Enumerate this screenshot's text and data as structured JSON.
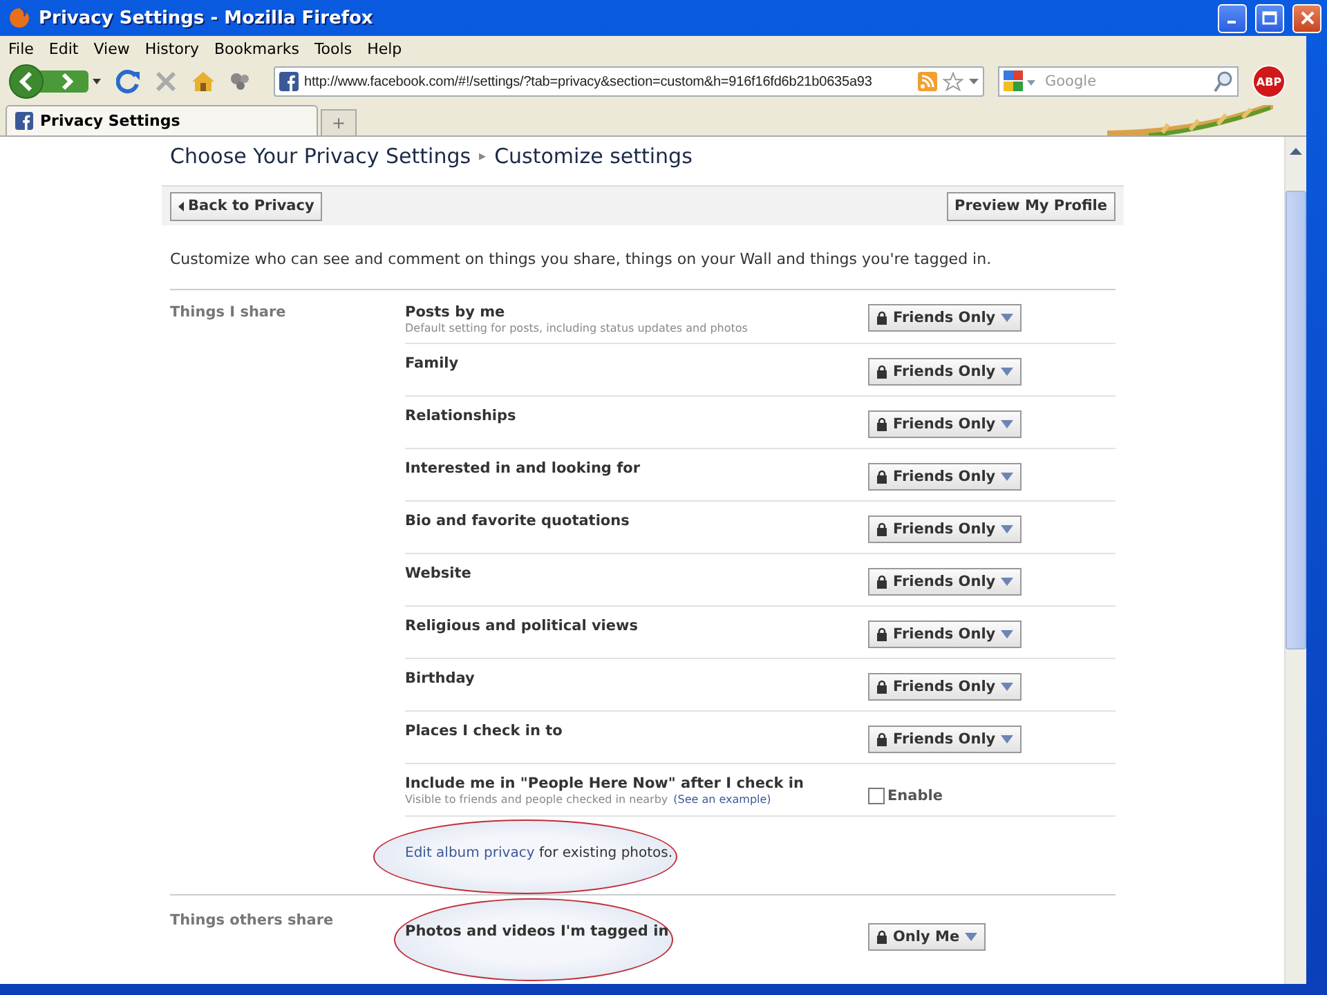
{
  "window": {
    "title": "Privacy Settings - Mozilla Firefox"
  },
  "menu": [
    "File",
    "Edit",
    "View",
    "History",
    "Bookmarks",
    "Tools",
    "Help"
  ],
  "address_bar": {
    "url": "http://www.facebook.com/#!/settings/?tab=privacy&section=custom&h=916f16fd6b21b0635a93"
  },
  "search": {
    "placeholder": "Google"
  },
  "adblock_label": "ABP",
  "tabs": [
    {
      "label": "Privacy Settings",
      "selected": true
    }
  ],
  "new_tab": "+",
  "breadcrumb": [
    "Choose Your Privacy Settings",
    "Customize settings"
  ],
  "breadcrumb_separator": "▸",
  "back_button": "Back to Privacy",
  "preview_button": "Preview My Profile",
  "intro": "Customize who can see and comment on things you share, things on your Wall and things you're tagged in.",
  "sections": [
    {
      "title": "Things I share",
      "rows": [
        {
          "kind": "select",
          "label": "Posts by me",
          "description": "Default setting for posts, including status updates and photos",
          "value": "Friends Only",
          "highlighted": false
        },
        {
          "kind": "select",
          "label": "Family",
          "value": "Friends Only",
          "highlighted": false
        },
        {
          "kind": "select",
          "label": "Relationships",
          "value": "Friends Only",
          "highlighted": false
        },
        {
          "kind": "select",
          "label": "Interested in and looking for",
          "value": "Friends Only",
          "highlighted": false
        },
        {
          "kind": "select",
          "label": "Bio and favorite quotations",
          "value": "Friends Only",
          "highlighted": false
        },
        {
          "kind": "select",
          "label": "Website",
          "value": "Friends Only",
          "highlighted": false
        },
        {
          "kind": "select",
          "label": "Religious and political views",
          "value": "Friends Only",
          "highlighted": false
        },
        {
          "kind": "select",
          "label": "Birthday",
          "value": "Friends Only",
          "highlighted": false
        },
        {
          "kind": "select",
          "label": "Places I check in to",
          "value": "Friends Only",
          "highlighted": false
        },
        {
          "kind": "checkbox",
          "label": "Include me in \"People Here Now\" after I check in",
          "description": "Visible to friends and people checked in nearby",
          "link": "(See an example)",
          "option": "Enable",
          "checked": false,
          "highlighted": false
        }
      ],
      "footer": {
        "link": "Edit album privacy",
        "text": " for existing photos.",
        "highlighted": true
      }
    },
    {
      "title": "Things others share",
      "rows": [
        {
          "kind": "select",
          "label": "Photos and videos I'm tagged in",
          "value": "Only Me",
          "highlighted": true
        }
      ]
    }
  ]
}
